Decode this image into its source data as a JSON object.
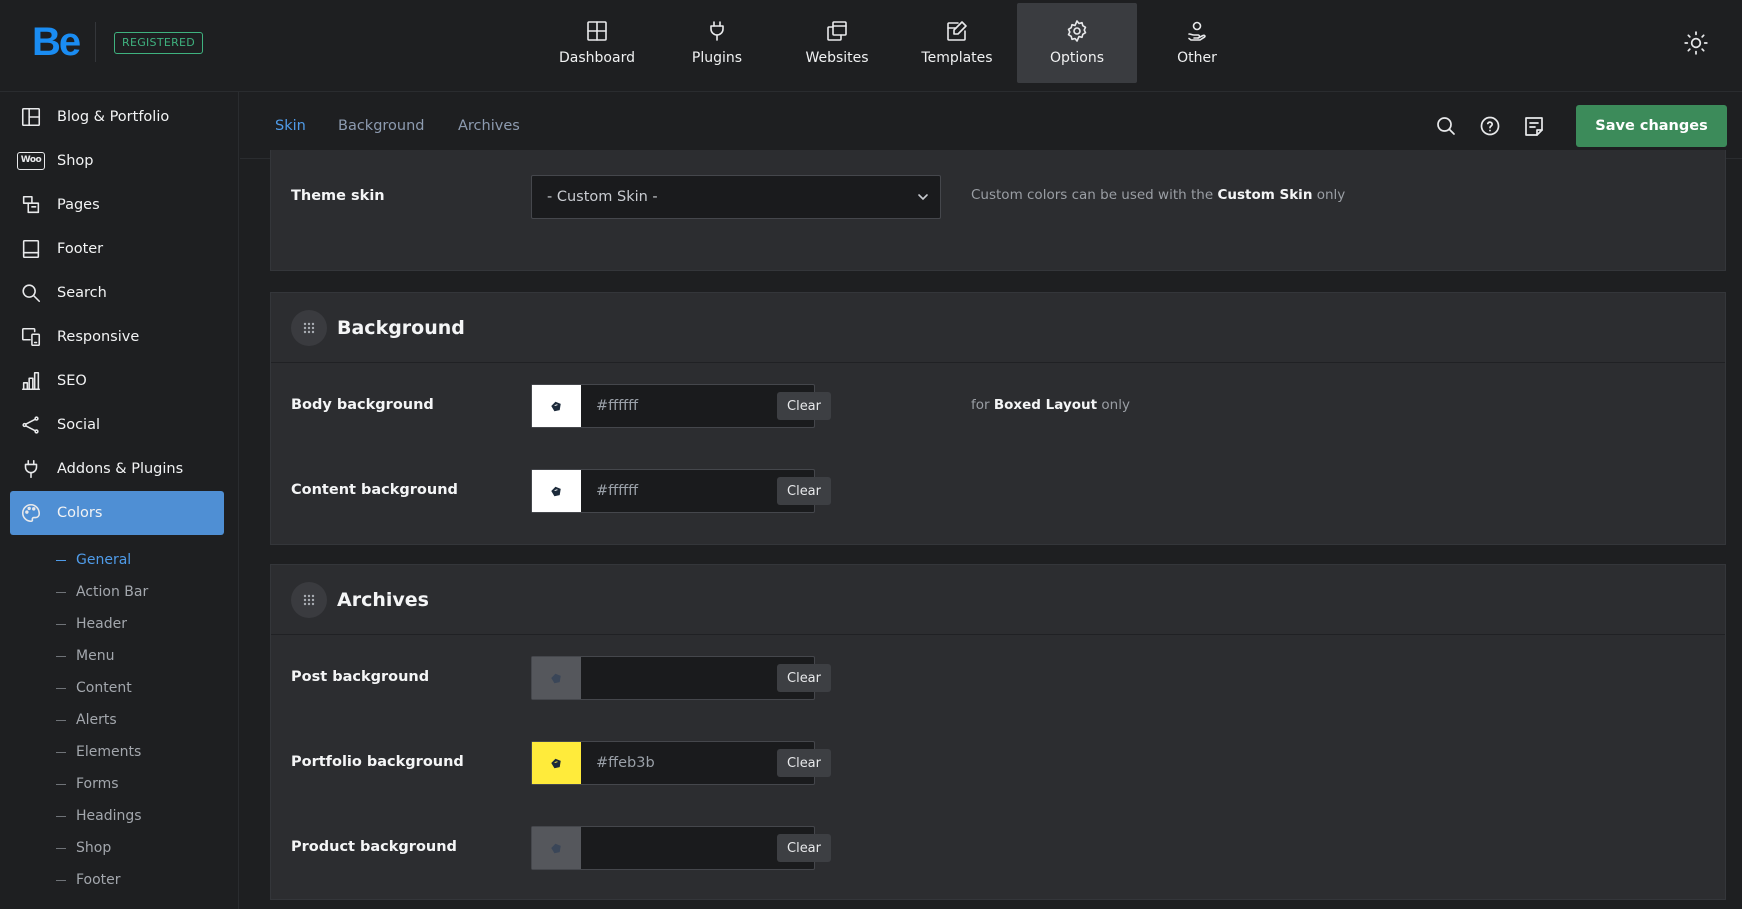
{
  "brand": {
    "logo_text": "Be",
    "badge": "REGISTERED",
    "logo_color": "#1a8cf2",
    "badge_color": "#3fb27f"
  },
  "topnav": [
    {
      "label": "Dashboard",
      "icon": "dashboard-icon"
    },
    {
      "label": "Plugins",
      "icon": "plug-icon"
    },
    {
      "label": "Websites",
      "icon": "websites-icon"
    },
    {
      "label": "Templates",
      "icon": "templates-icon"
    },
    {
      "label": "Options",
      "icon": "gear-icon",
      "active": true
    },
    {
      "label": "Other",
      "icon": "user-hand-icon"
    }
  ],
  "theme_toggle": {
    "icon": "sun-icon"
  },
  "sidebar": {
    "items": [
      {
        "label": "Blog & Portfolio",
        "icon": "layout-grid-icon"
      },
      {
        "label": "Shop",
        "icon": "woo-icon",
        "icon_text": "Woo"
      },
      {
        "label": "Pages",
        "icon": "pages-icon"
      },
      {
        "label": "Footer",
        "icon": "footer-icon"
      },
      {
        "label": "Search",
        "icon": "search-icon"
      },
      {
        "label": "Responsive",
        "icon": "responsive-icon"
      },
      {
        "label": "SEO",
        "icon": "bar-chart-icon"
      },
      {
        "label": "Social",
        "icon": "share-icon"
      },
      {
        "label": "Addons & Plugins",
        "icon": "plug-icon"
      },
      {
        "label": "Colors",
        "icon": "palette-icon",
        "active": true
      }
    ],
    "subitems": [
      {
        "label": "General",
        "active": true
      },
      {
        "label": "Action Bar"
      },
      {
        "label": "Header"
      },
      {
        "label": "Menu"
      },
      {
        "label": "Content"
      },
      {
        "label": "Alerts"
      },
      {
        "label": "Elements"
      },
      {
        "label": "Forms"
      },
      {
        "label": "Headings"
      },
      {
        "label": "Shop"
      },
      {
        "label": "Footer"
      }
    ],
    "active_color": "#4f8fd4"
  },
  "subheader": {
    "tabs": [
      {
        "label": "Skin",
        "active": true
      },
      {
        "label": "Background"
      },
      {
        "label": "Archives"
      }
    ],
    "save_label": "Save changes",
    "save_color": "#3c8b5a"
  },
  "skin_panel": {
    "theme_skin_label": "Theme skin",
    "theme_skin_value": "- Custom Skin -",
    "hint_prefix": "Custom colors can be used with the",
    "hint_bold": "Custom Skin",
    "hint_suffix": "only"
  },
  "background_panel": {
    "title": "Background",
    "rows": [
      {
        "label": "Body background",
        "value": "#ffffff",
        "swatch": "#ffffff",
        "clear": "Clear"
      },
      {
        "label": "Content background",
        "value": "#ffffff",
        "swatch": "#ffffff",
        "clear": "Clear"
      }
    ],
    "hint_prefix": "for",
    "hint_bold": "Boxed Layout",
    "hint_suffix": "only"
  },
  "archives_panel": {
    "title": "Archives",
    "rows": [
      {
        "label": "Post background",
        "value": "",
        "swatch": "#55575c",
        "clear": "Clear"
      },
      {
        "label": "Portfolio background",
        "value": "#ffeb3b",
        "swatch": "#ffeb3b",
        "clear": "Clear"
      },
      {
        "label": "Product background",
        "value": "",
        "swatch": "#55575c",
        "clear": "Clear"
      }
    ]
  }
}
